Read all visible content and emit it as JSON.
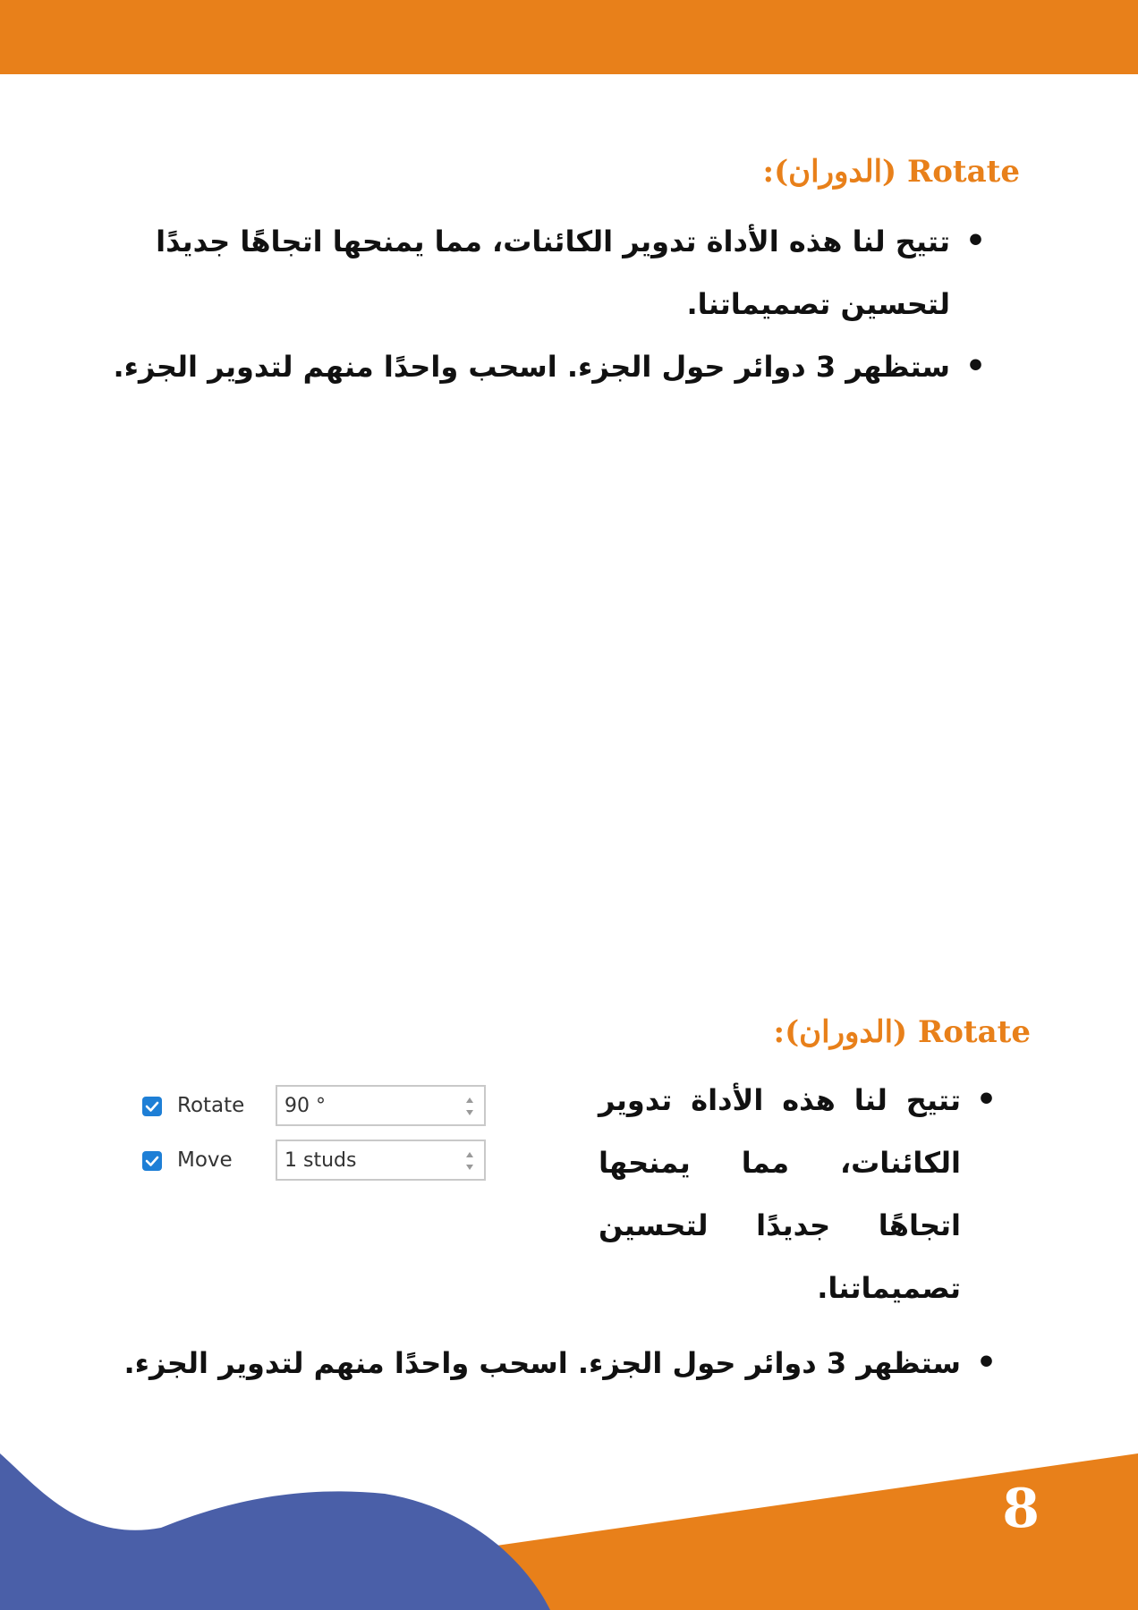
{
  "colors": {
    "accent": "#E8801A",
    "secondary": "#4A5FA8",
    "text": "#111111",
    "checkbox": "#1E7FD6"
  },
  "section_one": {
    "title": "Rotate (الدوران):",
    "bullets": [
      "تتيح لنا هذه الأداة تدوير الكائنات، مما يمنحها اتجاهًا جديدًا لتحسين تصميماتنا.",
      "ستظهر 3 دوائر حول الجزء. اسحب واحدًا منهم لتدوير الجزء."
    ]
  },
  "section_two": {
    "title": "Rotate (الدوران):",
    "bullets": [
      "تتيح لنا هذه الأداة تدوير الكائنات، مما يمنحها اتجاهًا جديدًا لتحسين تصميماتنا.",
      "ستظهر 3 دوائر حول الجزء. اسحب واحدًا منهم لتدوير الجزء."
    ]
  },
  "tool_panel": {
    "rotate": {
      "label": "Rotate",
      "value": "90 °",
      "checked": true,
      "icon": "checkmark-icon"
    },
    "move": {
      "label": "Move",
      "value": "1 studs",
      "checked": true,
      "icon": "checkmark-icon"
    }
  },
  "footer": {
    "page_number": "8"
  }
}
